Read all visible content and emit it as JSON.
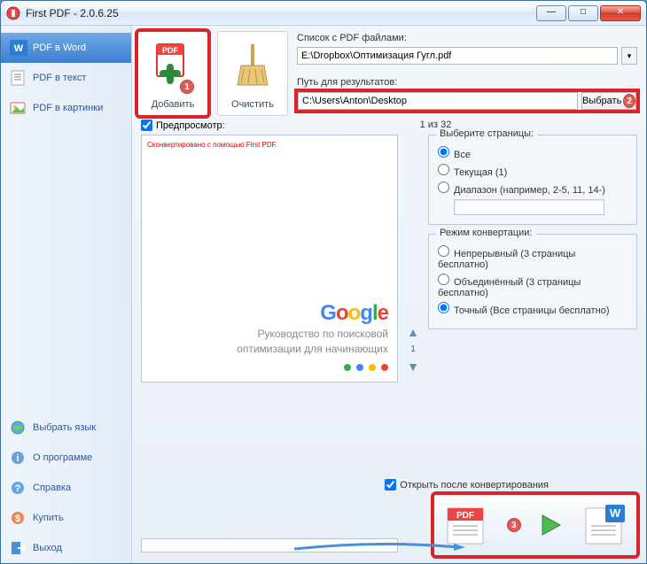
{
  "window": {
    "title": "First PDF - 2.0.6.25"
  },
  "sidebar": {
    "top": [
      {
        "label": "PDF в Word"
      },
      {
        "label": "PDF в текст"
      },
      {
        "label": "PDF в картинки"
      }
    ],
    "bottom": [
      {
        "label": "Выбрать язык"
      },
      {
        "label": "О программе"
      },
      {
        "label": "Справка"
      },
      {
        "label": "Купить"
      },
      {
        "label": "Выход"
      }
    ]
  },
  "toolbar": {
    "add_label": "Добавить",
    "clear_label": "Очистить",
    "add_step": "1"
  },
  "fields": {
    "list_label": "Список с PDF файлами:",
    "list_value": "E:\\Dropbox\\Оптимизация Гугл.pdf",
    "out_label": "Путь для результатов:",
    "out_value": "C:\\Users\\Anton\\Desktop",
    "choose_label": "Выбрать",
    "choose_step": "2"
  },
  "preview": {
    "checkbox_label": "Предпросмотр:",
    "page_info": "1 из 32",
    "watermark": "Сконвертировано с помощью First PDF.",
    "doc_line1": "Руководство по поисковой",
    "doc_line2": "оптимизации для начинающих",
    "current_page": "1"
  },
  "pages_group": {
    "legend": "Выберите страницы:",
    "all": "Все",
    "current": "Текущая (1)",
    "range": "Диапазон (например, 2-5, 11, 14-)",
    "selected": "all"
  },
  "mode_group": {
    "legend": "Режим конвертации:",
    "continuous": "Непрерывный (3 страницы бесплатно)",
    "merged": "Объединённый (3 страницы бесплатно)",
    "exact": "Точный (Все страницы бесплатно)",
    "selected": "exact"
  },
  "footer": {
    "open_after": "Открыть после конвертирования",
    "convert_step": "3"
  }
}
